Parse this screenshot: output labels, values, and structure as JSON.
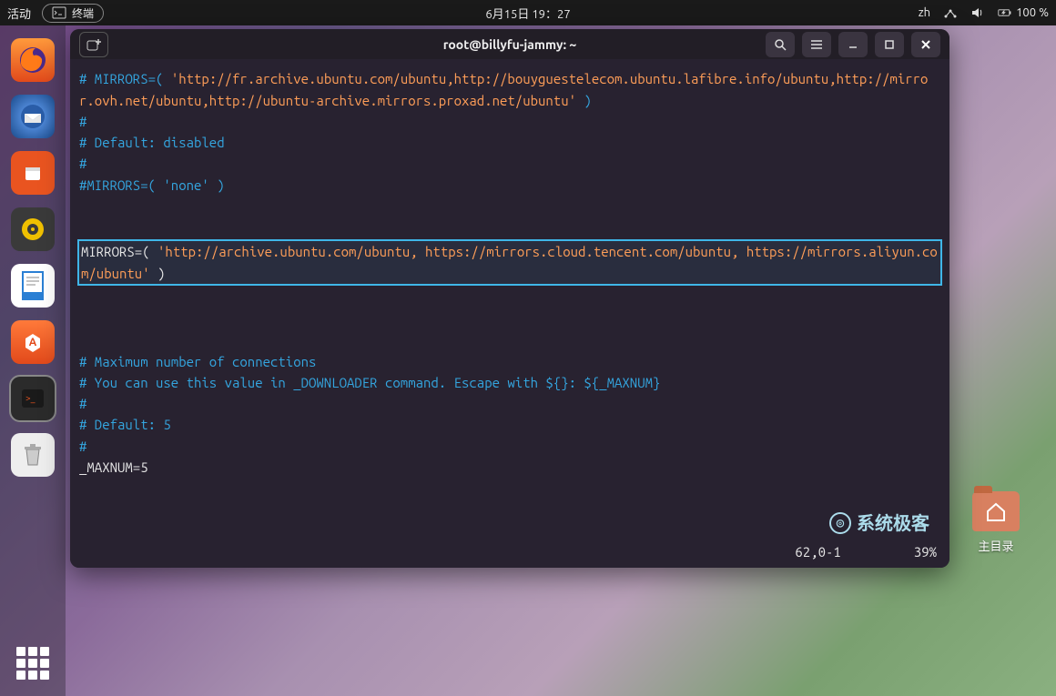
{
  "topbar": {
    "activities": "活动",
    "app_indicator": "终端",
    "datetime": "6月15日 19：27",
    "input_method": "zh",
    "battery": "100 %"
  },
  "dock": {
    "items": [
      {
        "name": "firefox",
        "color": "#ff7139",
        "glyph": "🦊"
      },
      {
        "name": "thunderbird",
        "color": "#2a5da8",
        "glyph": "✉"
      },
      {
        "name": "files",
        "color": "#e95420",
        "glyph": "📁"
      },
      {
        "name": "rhythmbox",
        "color": "#f0c000",
        "glyph": "🔊"
      },
      {
        "name": "libreoffice-writer",
        "color": "#2a7fd4",
        "glyph": "📄"
      },
      {
        "name": "software",
        "color": "#e95420",
        "glyph": "A"
      },
      {
        "name": "terminal",
        "color": "#333333",
        "glyph": ">_"
      },
      {
        "name": "trash",
        "color": "#dddddd",
        "glyph": "🗑"
      }
    ]
  },
  "desktop": {
    "home_label": "主目录"
  },
  "terminal": {
    "title": "root@billyfu-jammy: ~",
    "lines": {
      "l1a": "# MIRRORS=( ",
      "l1b": "'http://fr.archive.ubuntu.com/ubuntu,http://bouyguestelecom.ubuntu.lafibre.info/ubuntu,http://mirror.ovh.net/ubuntu,http://ubuntu-archive.mirrors.proxad.net/ubuntu'",
      "l1c": " )",
      "l2": "#",
      "l3": "# Default: disabled",
      "l4": "#",
      "l5": "#MIRRORS=( 'none' )",
      "blank1": "",
      "blank2": "",
      "assign_a": "MIRRORS=( ",
      "assign_b": "'http://archive.ubuntu.com/ubuntu, https://mirrors.cloud.tencent.com/ubuntu, https://mirrors.aliyun.com/ubuntu'",
      "assign_c": " )",
      "blank3": "",
      "blank4": "",
      "l6": "# Maximum number of connections",
      "l7": "# You can use this value in _DOWNLOADER command. Escape with ${}: ${_MAXNUM}",
      "l8": "#",
      "l9": "# Default: 5",
      "l10": "#",
      "l11": "_MAXNUM=5"
    },
    "status_pos": "62,0-1",
    "status_pct": "39%",
    "watermark": "系统极客"
  }
}
